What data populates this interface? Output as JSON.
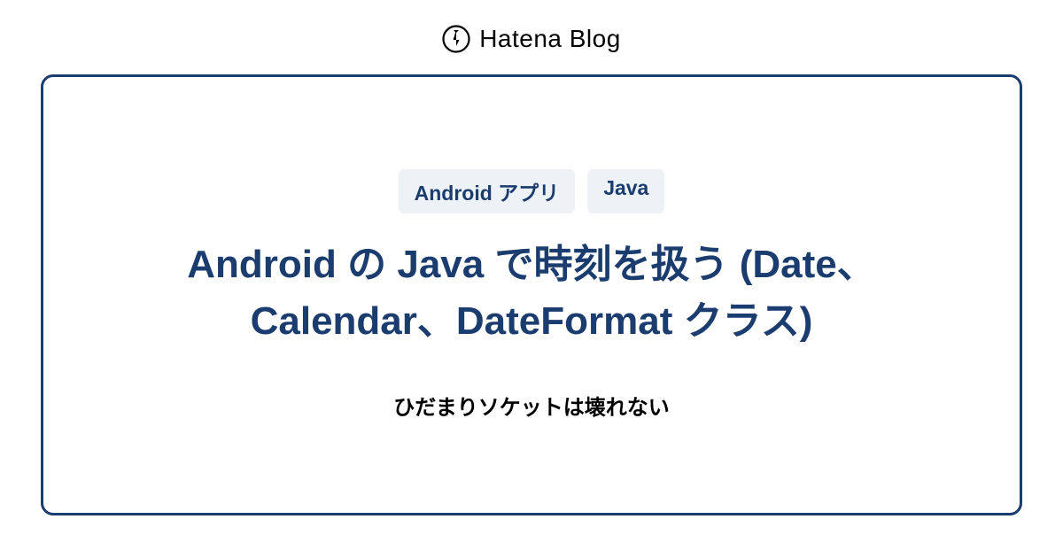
{
  "header": {
    "brand": "Hatena Blog"
  },
  "card": {
    "tags": [
      "Android アプリ",
      "Java"
    ],
    "title": "Android の Java で時刻を扱う (Date、Calendar、DateFormat クラス)",
    "subtitle": "ひだまりソケットは壊れない"
  }
}
